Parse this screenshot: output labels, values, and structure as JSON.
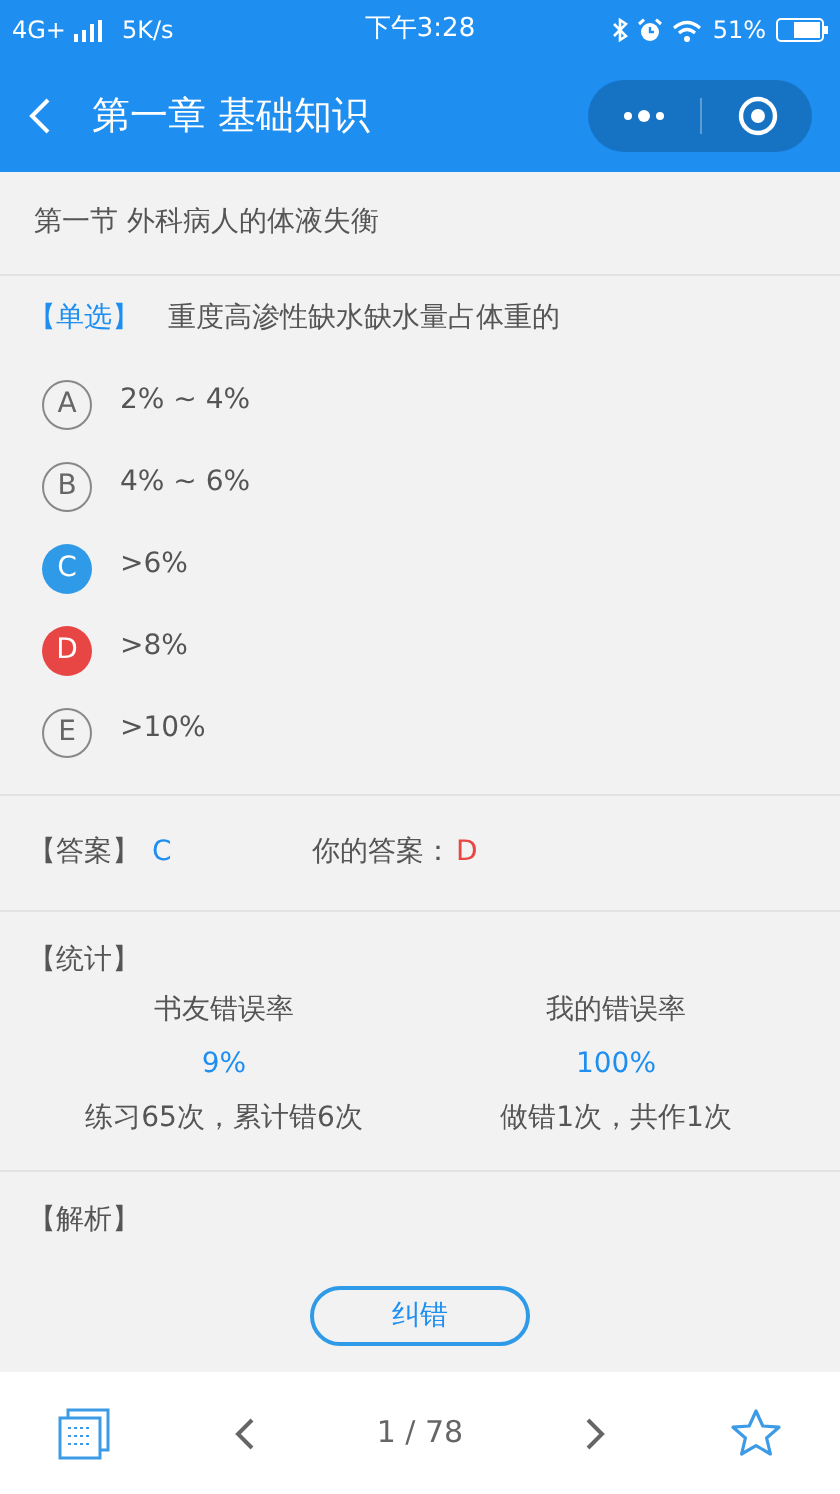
{
  "status_bar": {
    "network": "4G+",
    "speed": "5K/s",
    "time": "下午3:28",
    "battery": "51%"
  },
  "nav": {
    "title": "第一章 基础知识"
  },
  "section": "第一节 外科病人的体液失衡",
  "question": {
    "type": "【单选】",
    "text": "重度高渗性缺水缺水量占体重的",
    "options": [
      {
        "letter": "A",
        "text": "2% ~ 4%",
        "kind": "plain"
      },
      {
        "letter": "B",
        "text": "4% ~ 6%",
        "kind": "plain"
      },
      {
        "letter": "C",
        "text": ">6%",
        "kind": "correct"
      },
      {
        "letter": "D",
        "text": ">8%",
        "kind": "wrong"
      },
      {
        "letter": "E",
        "text": ">10%",
        "kind": "plain"
      }
    ]
  },
  "answer": {
    "label": "【答案】",
    "value": "C",
    "yours_label": "你的答案：",
    "yours_value": "D"
  },
  "stats": {
    "label": "【统计】",
    "columns": [
      {
        "title": "书友错误率",
        "value": "9%",
        "detail": "练习65次，累计错6次"
      },
      {
        "title": "我的错误率",
        "value": "100%",
        "detail": "做错1次，共作1次"
      }
    ]
  },
  "analysis": {
    "label": "【解析】"
  },
  "report_button": "纠错",
  "bottom_bar": {
    "page": "1 / 78"
  }
}
